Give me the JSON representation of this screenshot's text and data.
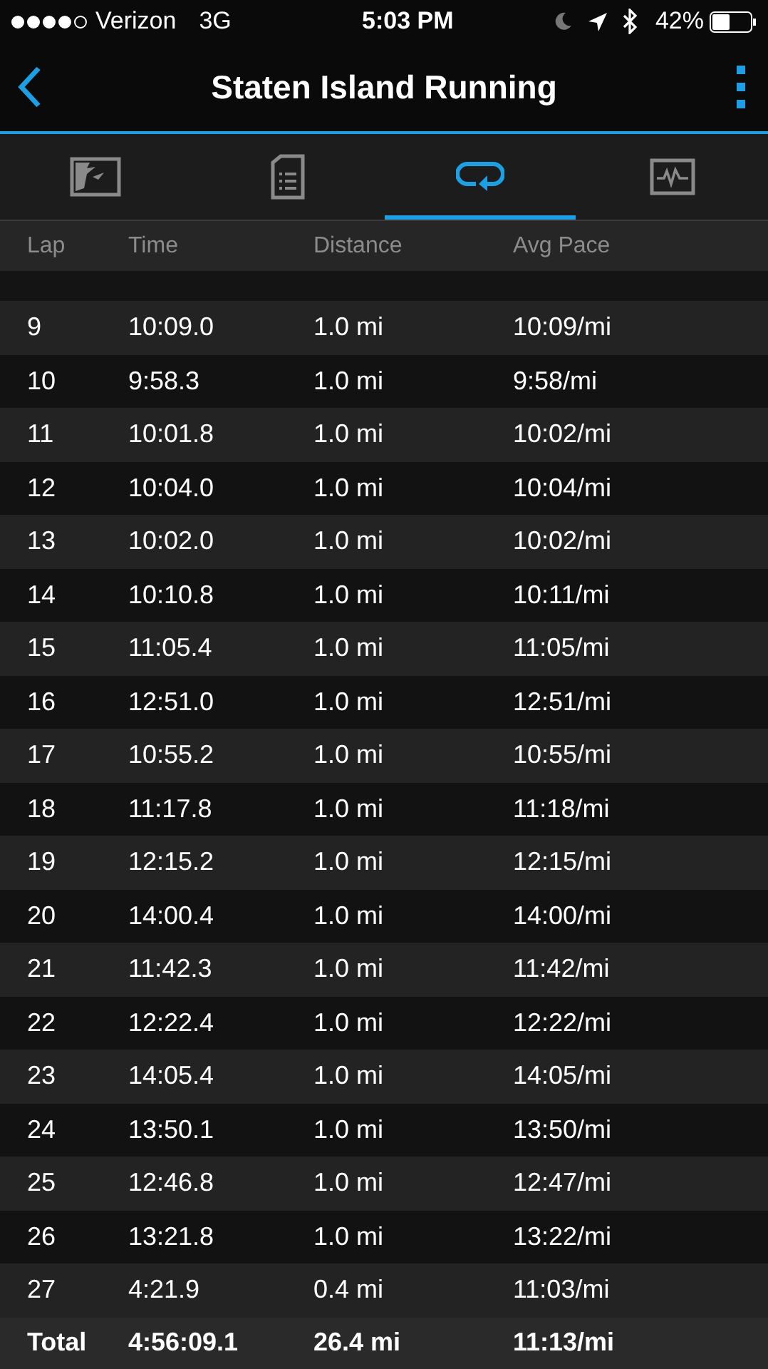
{
  "status_bar": {
    "carrier": "Verizon",
    "network": "3G",
    "time": "5:03 PM",
    "battery": "42%"
  },
  "header": {
    "title": "Staten Island Running"
  },
  "tabs": [
    {
      "selected": false
    },
    {
      "selected": false
    },
    {
      "selected": true
    },
    {
      "selected": false
    }
  ],
  "table": {
    "columns": [
      "Lap",
      "Time",
      "Distance",
      "Avg Pace"
    ],
    "rows": [
      [
        "9",
        "10:09.0",
        "1.0 mi",
        "10:09/mi"
      ],
      [
        "10",
        "9:58.3",
        "1.0 mi",
        "9:58/mi"
      ],
      [
        "11",
        "10:01.8",
        "1.0 mi",
        "10:02/mi"
      ],
      [
        "12",
        "10:04.0",
        "1.0 mi",
        "10:04/mi"
      ],
      [
        "13",
        "10:02.0",
        "1.0 mi",
        "10:02/mi"
      ],
      [
        "14",
        "10:10.8",
        "1.0 mi",
        "10:11/mi"
      ],
      [
        "15",
        "11:05.4",
        "1.0 mi",
        "11:05/mi"
      ],
      [
        "16",
        "12:51.0",
        "1.0 mi",
        "12:51/mi"
      ],
      [
        "17",
        "10:55.2",
        "1.0 mi",
        "10:55/mi"
      ],
      [
        "18",
        "11:17.8",
        "1.0 mi",
        "11:18/mi"
      ],
      [
        "19",
        "12:15.2",
        "1.0 mi",
        "12:15/mi"
      ],
      [
        "20",
        "14:00.4",
        "1.0 mi",
        "14:00/mi"
      ],
      [
        "21",
        "11:42.3",
        "1.0 mi",
        "11:42/mi"
      ],
      [
        "22",
        "12:22.4",
        "1.0 mi",
        "12:22/mi"
      ],
      [
        "23",
        "14:05.4",
        "1.0 mi",
        "14:05/mi"
      ],
      [
        "24",
        "13:50.1",
        "1.0 mi",
        "13:50/mi"
      ],
      [
        "25",
        "12:46.8",
        "1.0 mi",
        "12:47/mi"
      ],
      [
        "26",
        "13:21.8",
        "1.0 mi",
        "13:22/mi"
      ],
      [
        "27",
        "4:21.9",
        "0.4 mi",
        "11:03/mi"
      ]
    ],
    "total": [
      "Total",
      "4:56:09.1",
      "26.4 mi",
      "11:13/mi"
    ]
  }
}
